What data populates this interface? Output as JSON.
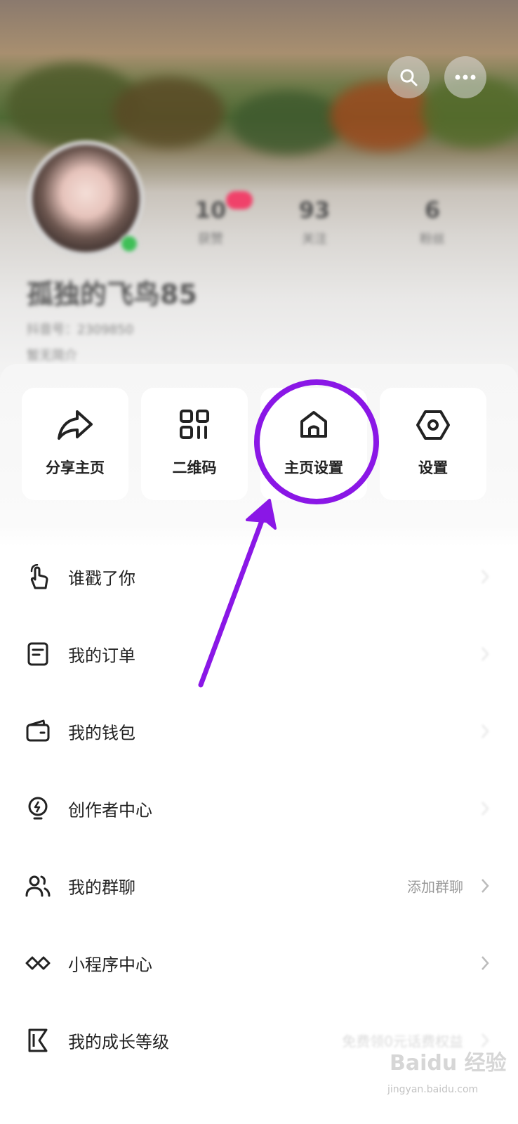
{
  "header": {
    "search_icon": "search-icon",
    "more_icon": "more-icon",
    "stats": [
      {
        "value": "10",
        "label": "获赞"
      },
      {
        "value": "93",
        "label": "关注"
      },
      {
        "value": "6",
        "label": "粉丝"
      }
    ],
    "nickname": "孤独的飞鸟85",
    "account_line": "抖音号：2309850",
    "bio": "暂无简介"
  },
  "quick_actions": [
    {
      "label": "分享主页",
      "icon": "share-icon"
    },
    {
      "label": "二维码",
      "icon": "qrcode-icon"
    },
    {
      "label": "主页设置",
      "icon": "home-icon"
    },
    {
      "label": "设置",
      "icon": "settings-icon"
    }
  ],
  "menu": [
    {
      "label": "谁戳了你",
      "icon": "tap-hand-icon",
      "right": ""
    },
    {
      "label": "我的订单",
      "icon": "order-icon",
      "right": ""
    },
    {
      "label": "我的钱包",
      "icon": "wallet-icon",
      "right": ""
    },
    {
      "label": "创作者中心",
      "icon": "creator-bulb-icon",
      "right": ""
    },
    {
      "label": "我的群聊",
      "icon": "group-icon",
      "right": "添加群聊"
    },
    {
      "label": "小程序中心",
      "icon": "mini-program-icon",
      "right": ""
    },
    {
      "label": "我的成长等级",
      "icon": "growth-level-icon",
      "right": "免费领0元话费权益"
    }
  ],
  "annotation": {
    "color": "#8a17e6"
  },
  "watermark": {
    "brand": "Baidu 经验",
    "url": "jingyan.baidu.com"
  }
}
